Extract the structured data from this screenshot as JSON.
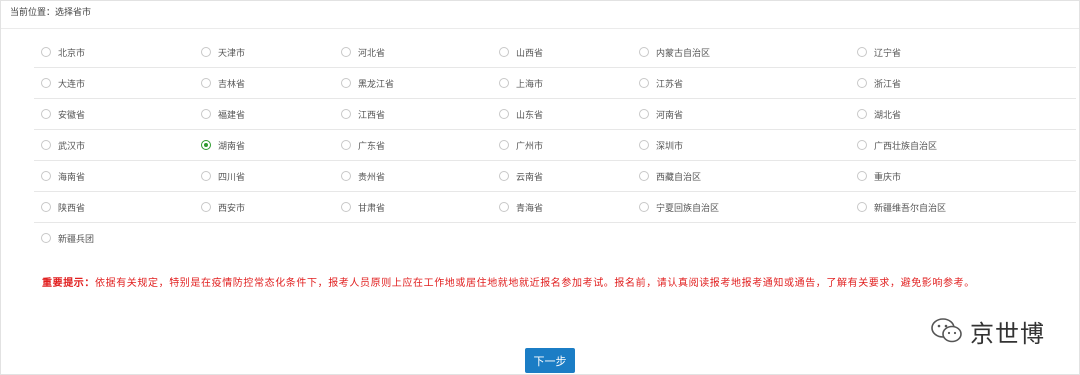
{
  "breadcrumb": "当前位置：选择省市",
  "options": [
    [
      "北京市",
      "天津市",
      "河北省",
      "山西省",
      "内蒙古自治区",
      "辽宁省"
    ],
    [
      "大连市",
      "吉林省",
      "黑龙江省",
      "上海市",
      "江苏省",
      "浙江省"
    ],
    [
      "安徽省",
      "福建省",
      "江西省",
      "山东省",
      "河南省",
      "湖北省"
    ],
    [
      "武汉市",
      "湖南省",
      "广东省",
      "广州市",
      "深圳市",
      "广西壮族自治区"
    ],
    [
      "海南省",
      "四川省",
      "贵州省",
      "云南省",
      "西藏自治区",
      "重庆市"
    ],
    [
      "陕西省",
      "西安市",
      "甘肃省",
      "青海省",
      "宁夏回族自治区",
      "新疆维吾尔自治区"
    ],
    [
      "新疆兵团"
    ]
  ],
  "selected": "湖南省",
  "notice": {
    "label": "重要提示：",
    "text": "依据有关规定，特别是在疫情防控常态化条件下，报考人员原则上应在工作地或居住地就地就近报名参加考试。报名前，请认真阅读报考地报考通知或通告，了解有关要求，避免影响参考。"
  },
  "next_button": "下一步",
  "watermark": "京世博",
  "colors": {
    "accent": "#1b7dc5",
    "notice": "#e11f1f",
    "checked": "#2e9b2e"
  }
}
